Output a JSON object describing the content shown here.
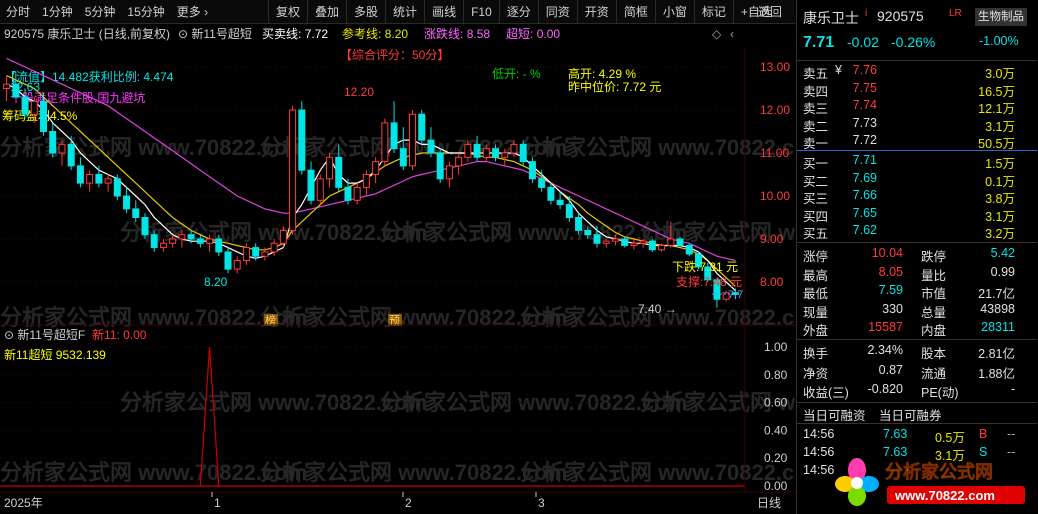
{
  "toolbar": {
    "left": [
      "分时",
      "1分钟",
      "5分钟",
      "15分钟",
      "更多 ›"
    ],
    "right": [
      "复权",
      "叠加",
      "多股",
      "统计",
      "画线",
      "F10",
      "逐分",
      "同资",
      "开资",
      "简框",
      "小窗",
      "标记",
      "+自选"
    ],
    "return": "返回"
  },
  "header": {
    "code_name": "920575 康乐卫士 (日线,前复权)",
    "indicator": "新11号超短",
    "mm_label": "买卖线:",
    "mm_value": "7.72",
    "ref_label": "参考线:",
    "ref_value": "8.20",
    "limit_label": "涨跌线:",
    "limit_value": "8.58",
    "chao_label": "超短:",
    "chao_value": "0.00",
    "score": "【综合评分：50分】"
  },
  "info": {
    "liutong": "【流值】14.482获利比例: 4.474",
    "tiaojian": "个股满足条件股,国九避坑",
    "chouma": "筹码盈利4.5%",
    "dikai": "低开: - %",
    "gaokai": "高开: 4.29 %",
    "zhongwei": "昨中位价: 7.72 元",
    "xiadie": "下跌:7.31 元",
    "zhicheng": "支撑:7.48 元",
    "high_mark1": "12.20",
    "high_mark2": "12.63",
    "low_mark": "8.20",
    "low_mark2": "7.40",
    "badge1": "榜",
    "badge2": "预",
    "price_right": "7.7"
  },
  "lower": {
    "title": "新11号超短F",
    "line_name": "新11: 0.00",
    "value_label": "新11超短 9532.139",
    "axis": [
      "1.00",
      "0.80",
      "0.60",
      "0.40",
      "0.20",
      "0.00"
    ]
  },
  "x_axis": {
    "labels": [
      "2025年",
      "1",
      "2",
      "3"
    ],
    "right_label": "日线"
  },
  "watermarks": [
    "分析家公式网",
    "www.70822.com"
  ],
  "chart_data": {
    "type": "candlestick",
    "y_ticks": [
      13.0,
      12.0,
      11.0,
      10.0,
      9.0,
      8.0
    ],
    "ohlc": [
      [
        12.5,
        12.8,
        12.2,
        12.6
      ],
      [
        12.6,
        12.9,
        12.4,
        12.3
      ],
      [
        12.3,
        12.5,
        11.8,
        11.9
      ],
      [
        11.9,
        12.3,
        11.7,
        12.2
      ],
      [
        12.2,
        12.4,
        11.4,
        11.5
      ],
      [
        11.5,
        11.7,
        10.9,
        11.0
      ],
      [
        11.0,
        11.3,
        10.7,
        11.2
      ],
      [
        11.2,
        11.4,
        10.6,
        10.7
      ],
      [
        10.7,
        10.9,
        10.2,
        10.3
      ],
      [
        10.3,
        10.6,
        10.1,
        10.5
      ],
      [
        10.5,
        10.7,
        10.2,
        10.3
      ],
      [
        10.3,
        10.5,
        10.1,
        10.4
      ],
      [
        10.4,
        10.5,
        9.9,
        10.0
      ],
      [
        10.0,
        10.2,
        9.6,
        9.7
      ],
      [
        9.7,
        9.9,
        9.4,
        9.5
      ],
      [
        9.5,
        9.6,
        9.0,
        9.1
      ],
      [
        9.1,
        9.2,
        8.7,
        8.8
      ],
      [
        8.8,
        9.0,
        8.7,
        8.9
      ],
      [
        8.9,
        9.1,
        8.8,
        9.0
      ],
      [
        9.0,
        9.2,
        8.8,
        9.1
      ],
      [
        9.1,
        9.2,
        8.9,
        9.0
      ],
      [
        9.0,
        9.1,
        8.8,
        8.9
      ],
      [
        8.9,
        9.1,
        8.7,
        9.0
      ],
      [
        9.0,
        9.1,
        8.6,
        8.7
      ],
      [
        8.7,
        8.8,
        8.2,
        8.3
      ],
      [
        8.3,
        8.6,
        8.2,
        8.5
      ],
      [
        8.5,
        8.9,
        8.4,
        8.8
      ],
      [
        8.8,
        8.9,
        8.5,
        8.6
      ],
      [
        8.6,
        8.8,
        8.5,
        8.7
      ],
      [
        8.7,
        9.0,
        8.6,
        8.9
      ],
      [
        8.9,
        9.3,
        8.8,
        9.2
      ],
      [
        9.2,
        12.1,
        9.1,
        12.0
      ],
      [
        12.0,
        12.2,
        10.5,
        10.6
      ],
      [
        10.6,
        10.8,
        9.8,
        9.9
      ],
      [
        9.9,
        10.5,
        9.8,
        10.4
      ],
      [
        10.4,
        11.0,
        10.2,
        10.9
      ],
      [
        10.9,
        11.2,
        10.1,
        10.2
      ],
      [
        10.2,
        10.4,
        9.8,
        9.9
      ],
      [
        9.9,
        10.3,
        9.8,
        10.2
      ],
      [
        10.2,
        10.6,
        10.0,
        10.5
      ],
      [
        10.5,
        10.9,
        10.3,
        10.8
      ],
      [
        10.8,
        11.8,
        10.7,
        11.7
      ],
      [
        11.7,
        12.2,
        11.0,
        11.1
      ],
      [
        11.1,
        11.6,
        10.6,
        10.7
      ],
      [
        10.7,
        12.0,
        10.6,
        11.9
      ],
      [
        11.9,
        12.0,
        11.2,
        11.3
      ],
      [
        11.3,
        11.6,
        10.9,
        11.0
      ],
      [
        11.0,
        11.1,
        10.3,
        10.4
      ],
      [
        10.4,
        10.8,
        10.2,
        10.7
      ],
      [
        10.7,
        11.0,
        10.5,
        10.9
      ],
      [
        10.9,
        11.3,
        10.8,
        11.2
      ],
      [
        11.2,
        11.4,
        10.8,
        10.9
      ],
      [
        10.9,
        11.2,
        10.8,
        11.1
      ],
      [
        11.1,
        11.2,
        10.8,
        10.9
      ],
      [
        10.9,
        11.1,
        10.7,
        11.0
      ],
      [
        11.0,
        11.3,
        10.9,
        11.2
      ],
      [
        11.2,
        11.3,
        10.7,
        10.8
      ],
      [
        10.8,
        10.9,
        10.3,
        10.4
      ],
      [
        10.4,
        10.6,
        10.1,
        10.2
      ],
      [
        10.2,
        10.3,
        9.8,
        9.9
      ],
      [
        9.9,
        10.1,
        9.7,
        9.8
      ],
      [
        9.8,
        10.0,
        9.4,
        9.5
      ],
      [
        9.5,
        9.6,
        9.1,
        9.2
      ],
      [
        9.2,
        9.3,
        9.0,
        9.1
      ],
      [
        9.1,
        9.3,
        8.8,
        8.9
      ],
      [
        8.9,
        9.0,
        8.8,
        8.95
      ],
      [
        8.95,
        9.1,
        8.85,
        9.0
      ],
      [
        9.0,
        9.05,
        8.8,
        8.85
      ],
      [
        8.85,
        9.0,
        8.75,
        8.9
      ],
      [
        8.9,
        9.0,
        8.8,
        8.95
      ],
      [
        8.95,
        9.0,
        8.7,
        8.75
      ],
      [
        8.75,
        8.9,
        8.7,
        8.85
      ],
      [
        8.85,
        9.4,
        8.8,
        9.0
      ],
      [
        9.0,
        9.05,
        8.8,
        8.85
      ],
      [
        8.85,
        8.9,
        8.6,
        8.65
      ],
      [
        8.65,
        8.7,
        8.3,
        8.35
      ],
      [
        8.35,
        8.45,
        8.0,
        8.05
      ],
      [
        8.05,
        8.1,
        7.4,
        7.6
      ],
      [
        7.6,
        7.8,
        7.55,
        7.75
      ],
      [
        7.75,
        7.85,
        7.6,
        7.71
      ]
    ],
    "ma5": [
      12.6,
      12.5,
      12.3,
      12.2,
      12.0,
      11.7,
      11.5,
      11.3,
      11.0,
      10.8,
      10.6,
      10.5,
      10.4,
      10.2,
      10.0,
      9.8,
      9.5,
      9.3,
      9.1,
      9.0,
      8.95,
      8.95,
      8.95,
      8.9,
      8.8,
      8.7,
      8.6,
      8.55,
      8.6,
      8.7,
      8.8,
      9.5,
      9.8,
      10.2,
      10.6,
      10.9,
      10.5,
      10.3,
      10.3,
      10.4,
      10.6,
      10.9,
      11.2,
      11.3,
      11.3,
      11.2,
      11.2,
      11.1,
      11.0,
      11.0,
      11.0,
      11.0,
      11.0,
      11.0,
      11.0,
      11.0,
      10.9,
      10.7,
      10.5,
      10.3,
      10.1,
      9.9,
      9.6,
      9.4,
      9.2,
      9.05,
      9.0,
      8.95,
      8.9,
      8.9,
      8.85,
      8.85,
      8.85,
      8.85,
      8.8,
      8.7,
      8.5,
      8.2,
      8.0,
      7.8
    ],
    "ma10": [
      12.8,
      12.7,
      12.6,
      12.5,
      12.3,
      12.1,
      11.9,
      11.7,
      11.5,
      11.3,
      11.1,
      10.9,
      10.7,
      10.5,
      10.3,
      10.1,
      9.9,
      9.7,
      9.5,
      9.35,
      9.2,
      9.1,
      9.0,
      8.95,
      8.9,
      8.85,
      8.8,
      8.75,
      8.75,
      8.8,
      8.9,
      9.2,
      9.4,
      9.6,
      9.8,
      10.0,
      10.1,
      10.2,
      10.3,
      10.4,
      10.55,
      10.7,
      10.8,
      10.9,
      10.95,
      11.0,
      11.0,
      11.0,
      11.0,
      11.0,
      11.0,
      10.95,
      10.9,
      10.9,
      10.85,
      10.8,
      10.7,
      10.6,
      10.45,
      10.3,
      10.1,
      9.95,
      9.8,
      9.6,
      9.45,
      9.3,
      9.15,
      9.05,
      9.0,
      8.95,
      8.9,
      8.85,
      8.85,
      8.8,
      8.75,
      8.65,
      8.5,
      8.3,
      8.1,
      7.9
    ],
    "ma20": [
      13.2,
      13.1,
      13.0,
      12.9,
      12.8,
      12.7,
      12.6,
      12.5,
      12.4,
      12.3,
      12.2,
      12.1,
      11.95,
      11.8,
      11.65,
      11.5,
      11.35,
      11.2,
      11.05,
      10.9,
      10.75,
      10.6,
      10.45,
      10.3,
      10.15,
      10.0,
      9.9,
      9.8,
      9.7,
      9.65,
      9.6,
      9.6,
      9.65,
      9.7,
      9.75,
      9.8,
      9.85,
      9.9,
      9.95,
      10.0,
      10.05,
      10.15,
      10.25,
      10.35,
      10.45,
      10.5,
      10.55,
      10.6,
      10.65,
      10.7,
      10.75,
      10.8,
      10.8,
      10.75,
      10.7,
      10.65,
      10.6,
      10.5,
      10.4,
      10.3,
      10.2,
      10.1,
      10.0,
      9.9,
      9.8,
      9.7,
      9.6,
      9.5,
      9.4,
      9.3,
      9.2,
      9.1,
      9.0,
      8.95,
      8.9,
      8.8,
      8.7,
      8.6,
      8.55,
      8.5
    ],
    "spike_index": 22
  },
  "quote": {
    "name": "康乐卫士",
    "code": "920575",
    "tag": "LR",
    "industry": "生物制品",
    "price": "7.71",
    "change": "-0.02",
    "pct": "-0.26%",
    "industry_pct": "-1.00%",
    "asks": [
      {
        "label": "卖五",
        "mark": "¥",
        "price": "7.76",
        "vol": "3.0万"
      },
      {
        "label": "卖四",
        "mark": "",
        "price": "7.75",
        "vol": "16.5万"
      },
      {
        "label": "卖三",
        "mark": "",
        "price": "7.74",
        "vol": "12.1万"
      },
      {
        "label": "卖二",
        "mark": "",
        "price": "7.73",
        "vol": "3.1万"
      },
      {
        "label": "卖一",
        "mark": "",
        "price": "7.72",
        "vol": "50.5万"
      }
    ],
    "bids": [
      {
        "label": "买一",
        "price": "7.71",
        "vol": "1.5万"
      },
      {
        "label": "买二",
        "price": "7.69",
        "vol": "0.1万"
      },
      {
        "label": "买三",
        "price": "7.66",
        "vol": "3.8万"
      },
      {
        "label": "买四",
        "price": "7.65",
        "vol": "3.1万"
      },
      {
        "label": "买五",
        "price": "7.62",
        "vol": "3.2万"
      }
    ],
    "stats": [
      [
        "涨停",
        "10.04",
        "跌停",
        "5.42"
      ],
      [
        "最高",
        "8.05",
        "量比",
        "0.99"
      ],
      [
        "最低",
        "7.59",
        "市值",
        "21.7亿"
      ],
      [
        "现量",
        "330",
        "总量",
        "43898"
      ],
      [
        "外盘",
        "15587",
        "内盘",
        "28311"
      ]
    ],
    "stats2": [
      [
        "换手",
        "2.34%",
        "股本",
        "2.81亿"
      ],
      [
        "净资",
        "0.87",
        "流通",
        "1.88亿"
      ],
      [
        "收益(三)",
        "-0.820",
        "PE(动)",
        "-"
      ]
    ],
    "margin_tabs": [
      "当日可融资",
      "当日可融券"
    ],
    "ticks": [
      {
        "time": "14:56",
        "price": "7.63",
        "vol": "0.5万",
        "side": "B",
        "extra": "--"
      },
      {
        "time": "14:56",
        "price": "7.63",
        "vol": "3.1万",
        "side": "S",
        "extra": "--"
      },
      {
        "time": "14:56",
        "price": "",
        "vol": "",
        "side": "",
        "extra": ""
      }
    ]
  },
  "logo": {
    "text": "分析家公式网",
    "url": "www.70822.com"
  }
}
